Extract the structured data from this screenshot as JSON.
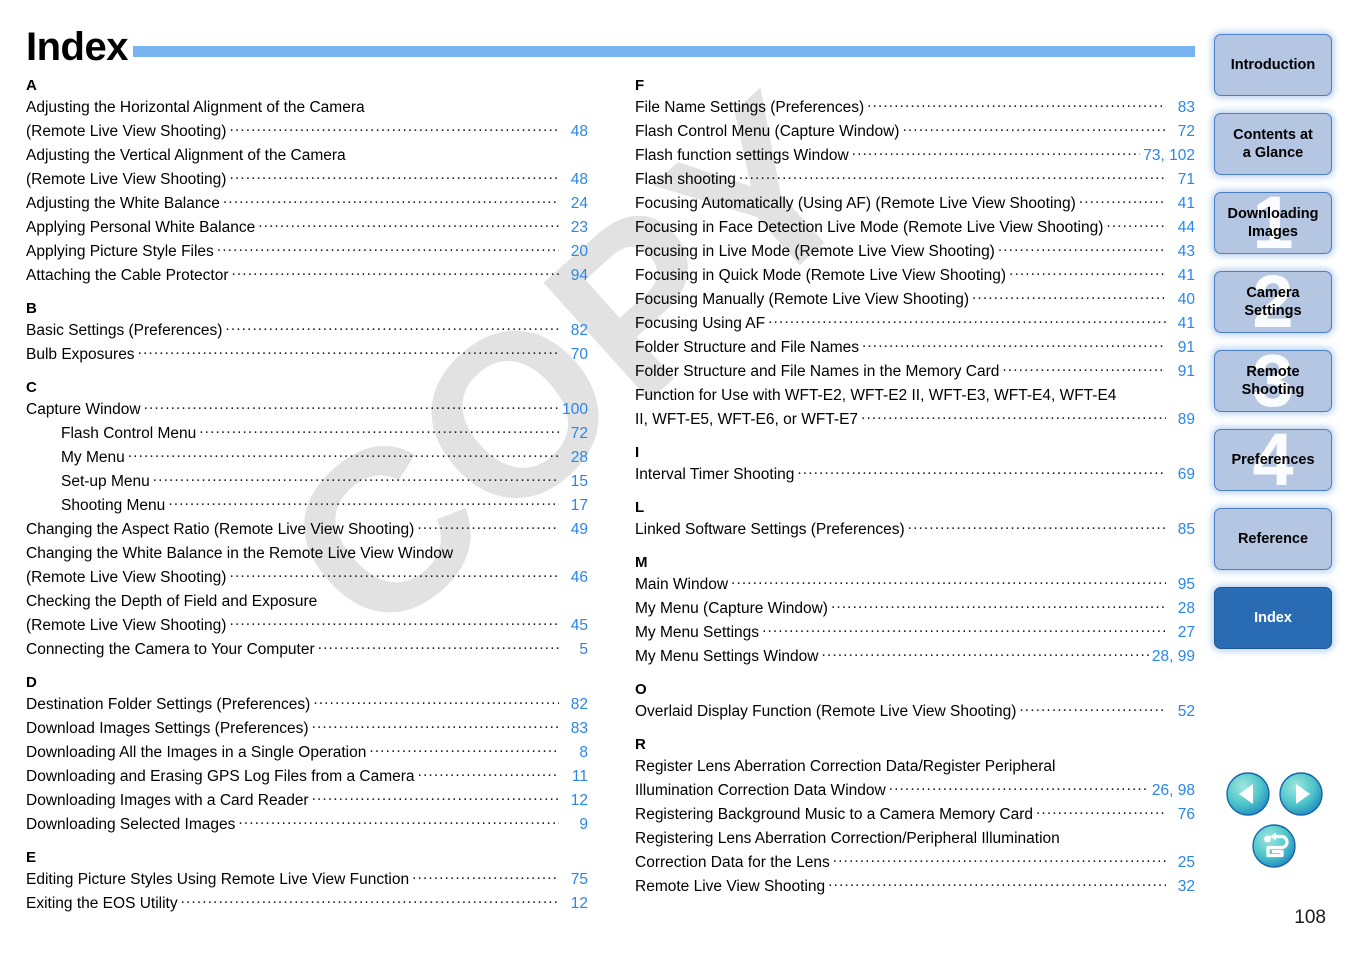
{
  "page": {
    "title": "Index",
    "page_number": "108",
    "watermark": "COPY",
    "accent_rule_color": "#79b4f2",
    "pagenum_color": "#2a86e8",
    "active_tab_color": "#2a6cb4",
    "tab_color": "#b4c6e2"
  },
  "sidebar": {
    "tabs": [
      {
        "label": "Introduction",
        "number": "",
        "active": false
      },
      {
        "label": "Contents at\na Glance",
        "number": "",
        "active": false
      },
      {
        "label": "Downloading\nImages",
        "number": "1",
        "active": false
      },
      {
        "label": "Camera\nSettings",
        "number": "2",
        "active": false
      },
      {
        "label": "Remote\nShooting",
        "number": "3",
        "active": false
      },
      {
        "label": "Preferences",
        "number": "4",
        "active": false
      },
      {
        "label": "Reference",
        "number": "",
        "active": false
      },
      {
        "label": "Index",
        "number": "",
        "active": true
      }
    ]
  },
  "nav_buttons": [
    {
      "name": "previous-page-button",
      "icon": "left-triangle-icon"
    },
    {
      "name": "next-page-button",
      "icon": "right-triangle-icon"
    },
    {
      "name": "return-button",
      "icon": "return-arrow-icon"
    }
  ],
  "columns": {
    "left": [
      {
        "letter": "A",
        "entries": [
          {
            "label": "Adjusting the Horizontal Alignment of the Camera",
            "page": "",
            "leader": false,
            "sub": false
          },
          {
            "label": "(Remote Live View Shooting)",
            "page": "48",
            "leader": true,
            "sub": false
          },
          {
            "label": "Adjusting the Vertical Alignment of the Camera",
            "page": "",
            "leader": false,
            "sub": false
          },
          {
            "label": "(Remote Live View Shooting)",
            "page": "48",
            "leader": true,
            "sub": false
          },
          {
            "label": "Adjusting the White Balance",
            "page": "24",
            "leader": true,
            "sub": false
          },
          {
            "label": "Applying Personal White Balance",
            "page": "23",
            "leader": true,
            "sub": false
          },
          {
            "label": "Applying Picture Style Files",
            "page": "20",
            "leader": true,
            "sub": false
          },
          {
            "label": "Attaching the Cable Protector",
            "page": "94",
            "leader": true,
            "sub": false
          }
        ]
      },
      {
        "letter": "B",
        "entries": [
          {
            "label": "Basic Settings (Preferences)",
            "page": "82",
            "leader": true,
            "sub": false
          },
          {
            "label": "Bulb Exposures",
            "page": "70",
            "leader": true,
            "sub": false
          }
        ]
      },
      {
        "letter": "C",
        "entries": [
          {
            "label": "Capture Window",
            "page": "100",
            "leader": true,
            "sub": false
          },
          {
            "label": "Flash Control Menu",
            "page": "72",
            "leader": true,
            "sub": true
          },
          {
            "label": "My Menu",
            "page": "28",
            "leader": true,
            "sub": true
          },
          {
            "label": "Set-up Menu",
            "page": "15",
            "leader": true,
            "sub": true
          },
          {
            "label": "Shooting Menu",
            "page": "17",
            "leader": true,
            "sub": true
          },
          {
            "label": "Changing the Aspect Ratio (Remote Live View Shooting)",
            "page": "49",
            "leader": true,
            "sub": false
          },
          {
            "label": "Changing the White Balance in the Remote Live View Window",
            "page": "",
            "leader": false,
            "sub": false
          },
          {
            "label": "(Remote Live View Shooting)",
            "page": "46",
            "leader": true,
            "sub": false
          },
          {
            "label": "Checking the Depth of Field and Exposure",
            "page": "",
            "leader": false,
            "sub": false
          },
          {
            "label": "(Remote Live View Shooting)",
            "page": "45",
            "leader": true,
            "sub": false
          },
          {
            "label": "Connecting the Camera to Your Computer",
            "page": "5",
            "leader": true,
            "sub": false
          }
        ]
      },
      {
        "letter": "D",
        "entries": [
          {
            "label": "Destination Folder Settings (Preferences)",
            "page": "82",
            "leader": true,
            "sub": false
          },
          {
            "label": "Download Images Settings (Preferences)",
            "page": "83",
            "leader": true,
            "sub": false
          },
          {
            "label": "Downloading All the Images in a Single Operation",
            "page": "8",
            "leader": true,
            "sub": false
          },
          {
            "label": "Downloading and Erasing GPS Log Files from a Camera",
            "page": "11",
            "leader": true,
            "sub": false
          },
          {
            "label": "Downloading Images with a Card Reader",
            "page": "12",
            "leader": true,
            "sub": false
          },
          {
            "label": "Downloading Selected Images",
            "page": "9",
            "leader": true,
            "sub": false
          }
        ]
      },
      {
        "letter": "E",
        "entries": [
          {
            "label": "Editing Picture Styles Using Remote Live View Function",
            "page": "75",
            "leader": true,
            "sub": false
          },
          {
            "label": "Exiting the EOS Utility",
            "page": "12",
            "leader": true,
            "sub": false
          }
        ]
      }
    ],
    "right": [
      {
        "letter": "F",
        "entries": [
          {
            "label": "File Name Settings (Preferences)",
            "page": "83",
            "leader": true,
            "sub": false
          },
          {
            "label": "Flash Control Menu (Capture Window)",
            "page": "72",
            "leader": true,
            "sub": false
          },
          {
            "label": "Flash function settings Window",
            "page": "73, 102",
            "leader": true,
            "sub": false
          },
          {
            "label": "Flash shooting",
            "page": "71",
            "leader": true,
            "sub": false
          },
          {
            "label": "Focusing Automatically (Using AF) (Remote Live View Shooting)",
            "page": "41",
            "leader": true,
            "sub": false
          },
          {
            "label": "Focusing in Face Detection Live Mode (Remote Live View Shooting)",
            "page": "44",
            "leader": true,
            "sub": false
          },
          {
            "label": "Focusing in Live Mode (Remote Live View Shooting)",
            "page": "43",
            "leader": true,
            "sub": false
          },
          {
            "label": "Focusing in Quick Mode (Remote Live View Shooting)",
            "page": "41",
            "leader": true,
            "sub": false
          },
          {
            "label": "Focusing Manually (Remote Live View Shooting)",
            "page": "40",
            "leader": true,
            "sub": false
          },
          {
            "label": "Focusing Using AF",
            "page": "41",
            "leader": true,
            "sub": false
          },
          {
            "label": "Folder Structure and File Names",
            "page": "91",
            "leader": true,
            "sub": false
          },
          {
            "label": "Folder Structure and File Names in the Memory Card",
            "page": "91",
            "leader": true,
            "sub": false
          },
          {
            "label": "Function for Use with WFT-E2, WFT-E2 II, WFT-E3, WFT-E4, WFT-E4",
            "page": "",
            "leader": false,
            "sub": false
          },
          {
            "label": "II, WFT-E5, WFT-E6, or WFT-E7",
            "page": "89",
            "leader": true,
            "sub": false
          }
        ]
      },
      {
        "letter": "I",
        "entries": [
          {
            "label": "Interval Timer Shooting",
            "page": "69",
            "leader": true,
            "sub": false
          }
        ]
      },
      {
        "letter": "L",
        "entries": [
          {
            "label": "Linked Software Settings (Preferences)",
            "page": "85",
            "leader": true,
            "sub": false
          }
        ]
      },
      {
        "letter": "M",
        "entries": [
          {
            "label": "Main Window",
            "page": "95",
            "leader": true,
            "sub": false
          },
          {
            "label": "My Menu (Capture Window)",
            "page": "28",
            "leader": true,
            "sub": false
          },
          {
            "label": "My Menu Settings",
            "page": "27",
            "leader": true,
            "sub": false
          },
          {
            "label": "My Menu Settings Window",
            "page": "28, 99",
            "leader": true,
            "sub": false
          }
        ]
      },
      {
        "letter": "O",
        "entries": [
          {
            "label": "Overlaid Display Function (Remote Live View Shooting)",
            "page": "52",
            "leader": true,
            "sub": false
          }
        ]
      },
      {
        "letter": "R",
        "entries": [
          {
            "label": "Register Lens Aberration Correction Data/Register Peripheral",
            "page": "",
            "leader": false,
            "sub": false
          },
          {
            "label": "Illumination Correction Data Window",
            "page": "26, 98",
            "leader": true,
            "sub": false
          },
          {
            "label": "Registering Background Music to a Camera Memory Card",
            "page": "76",
            "leader": true,
            "sub": false
          },
          {
            "label": "Registering Lens Aberration Correction/Peripheral Illumination",
            "page": "",
            "leader": false,
            "sub": false
          },
          {
            "label": "Correction Data for the Lens",
            "page": "25",
            "leader": true,
            "sub": false
          },
          {
            "label": "Remote Live View Shooting",
            "page": "32",
            "leader": true,
            "sub": false
          }
        ]
      }
    ]
  }
}
